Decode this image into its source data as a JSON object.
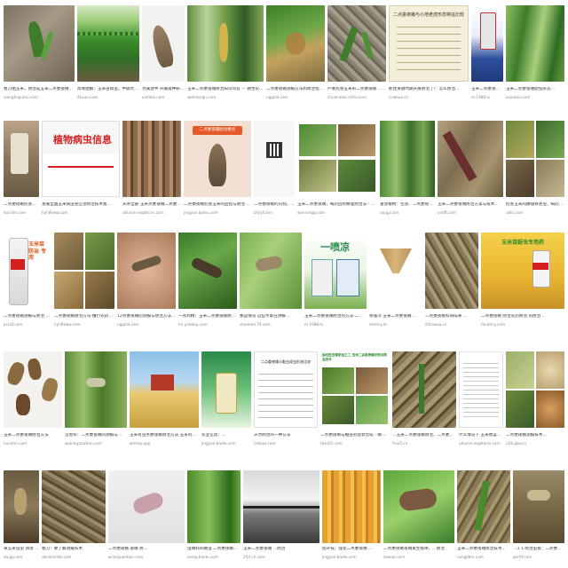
{
  "results": [
    {
      "caption": "春刀晒玉米，防治成玉米二点委夜蛾的防治与…",
      "source": "xiangfeiyumu.com"
    },
    {
      "caption": "简易图解：玉米苗螟虫，中期大螟害，虚整体会…",
      "source": "ifkuan.com"
    },
    {
      "caption": "为属暨中 开展菌种研究提供领导…",
      "source": "xinhkle.com"
    },
    {
      "caption": "玉米二点委夜蛾防治知识问答 － 微生农…",
      "source": "weiheorgn.com"
    },
    {
      "caption": "二点委夜蛾测报方法和防治措施 - 百度文库",
      "source": "nggold.com"
    },
    {
      "caption": "严重危害玉米的二点委夜蛾…测报方法…",
      "source": "chuandian.chitu.com"
    },
    {
      "caption": "抓住关键时期开展防治了？ 怎么防治…",
      "source": "ccwhua.cn"
    },
    {
      "caption": "玉米二点委夜蛾防治技术",
      "source": "m.1988.tv"
    },
    {
      "caption": "玉米二点委夜蛾幼虫形态…",
      "source": "sozuozu.com"
    },
    {
      "caption": "二点委夜蛾危害识别与防治 玉米苗期 防治…",
      "source": "huirahr.com"
    },
    {
      "caption": "发展全国玉米病虫害应急防治技术会…",
      "source": "hyh8kww.com"
    },
    {
      "caption": "头条全部 玉米点委夜蛾二点委夜蛾，需依照…",
      "source": "ahianm.eoghtcns.com"
    },
    {
      "caption": "二点委夜蛾危害玉米的监控与防治 百度经验",
      "source": "jingyan.baidu.com"
    },
    {
      "caption": "二点委夜蛾的识别，防御建议，防治…",
      "source": "lzfyyf.com"
    },
    {
      "caption": "玉米二点委夜蛾，喝药后的精准防治法 - 微信百科",
      "source": "wanrongg.com"
    },
    {
      "caption": "富含植物：包含、二点委夜蛾，稳准防治…",
      "source": "sw.gy.com"
    },
    {
      "caption": "玉米二点委夜蛾防治方案与技术…",
      "source": "yodft.com"
    },
    {
      "caption": "危害玉米的鳞翅目害虫，喝药后防治…",
      "source": "ukfu.com"
    },
    {
      "caption": "二点委夜蛾测报与防治 特别提示…",
      "source": "pcuzf.com"
    },
    {
      "caption": "二点委夜蛾防治方法-推行农药…",
      "source": "hyh8kww.com"
    },
    {
      "caption": "12点委夜蛾的测报与防治方法…",
      "source": "nggold.com"
    },
    {
      "caption": "一点鸡精：玉米二点委夜蛾防治方法(图)…",
      "source": "hn.yotobuj.com"
    },
    {
      "caption": "那些情况 这些专家在讲解…",
      "source": "shoeeed.T4.com"
    },
    {
      "caption": "玉米二点委夜蛾防治的方法-二点委夜蛾防治…",
      "source": "m.1988.tv"
    },
    {
      "caption": "喷施凉 玉米二点委夜蛾…",
      "source": "dvzhny.tn"
    },
    {
      "caption": "二点委夜蛾科研成果 …",
      "source": "ilitcowsa.cz"
    },
    {
      "caption": "二点委夜蛾 防治农药防治 的防治…",
      "source": "tanatiny.com"
    },
    {
      "caption": "玉米二点委夜蛾防治方法",
      "source": "hunstm.com"
    },
    {
      "caption": "沿害科：二点委夜蛾的测报与…",
      "source": "wuking.bozhan.com"
    },
    {
      "caption": "玉米有虫点委夜蛾防治方法 玉米的研究测…",
      "source": "wmrsp.app"
    },
    {
      "caption": "农业信息：…",
      "source": "jingyan.baidu.com"
    },
    {
      "caption": "天然防治的一种方法",
      "source": "laobao.com"
    },
    {
      "caption": "二点委夜蛾与黏虫的症状比较 - 微信百科…",
      "source": "teso01.com"
    },
    {
      "caption": "…玉米二点委夜蛾防治，二点委夜蛾…",
      "source": "frux5.cn"
    },
    {
      "caption": "什么情况下 玉米地菜的 二点委夜蛾…",
      "source": "ahianm.eoghtcns.com"
    },
    {
      "caption": "二点委夜蛾测报技术…",
      "source": "u56.gov.cn"
    },
    {
      "caption": "黄玉米虫虫 测试 二点委夜蛾…",
      "source": "sw.gy.com"
    },
    {
      "caption": "春刀：要了解测报技术",
      "source": "ahuizmmbi.com"
    },
    {
      "caption": "二点委夜蛾 夜蛾 防…",
      "source": "w.laoyuanban.com"
    },
    {
      "caption": "虫蛾科的蛾虫 二点委夜蛾…",
      "source": "sarxq.baidu.com"
    },
    {
      "caption": "玉米二点委夜蛾 …防治",
      "source": "25d.cn.com"
    },
    {
      "caption": "提升技，强化二点委夜蛾 …",
      "source": "jingyan.baidu.com"
    },
    {
      "caption": "二点委夜蛾夜蛾发生规律，…防治",
      "source": "laoxue.com"
    },
    {
      "caption": "玉米二点委夜蛾防治技术…",
      "source": "nongzbm.com"
    },
    {
      "caption": "…1 1 防治虫夜：二点委…",
      "source": "gnr0f.com"
    },
    {
      "caption": "二点委夜蛾的防治技术…",
      "source": "yeesme.com"
    }
  ],
  "thumb_text": {
    "chart_title": "二点委夜蛾与小地老虎形态特征比较",
    "plant_info": "植物病虫信息",
    "banner_label": "二点委夜蛾防治要点",
    "pesticide": "玉米苗 防治 专用",
    "spray_brand": "一喷凉",
    "product_banner": "玉米苗蚜虫专用药",
    "doc_title": "二点委夜蛾与黏虫成虫形态比较",
    "guide_title": "盐蛀性虫害防治之二 玉米二点委夜蛾识别与防治技术"
  }
}
